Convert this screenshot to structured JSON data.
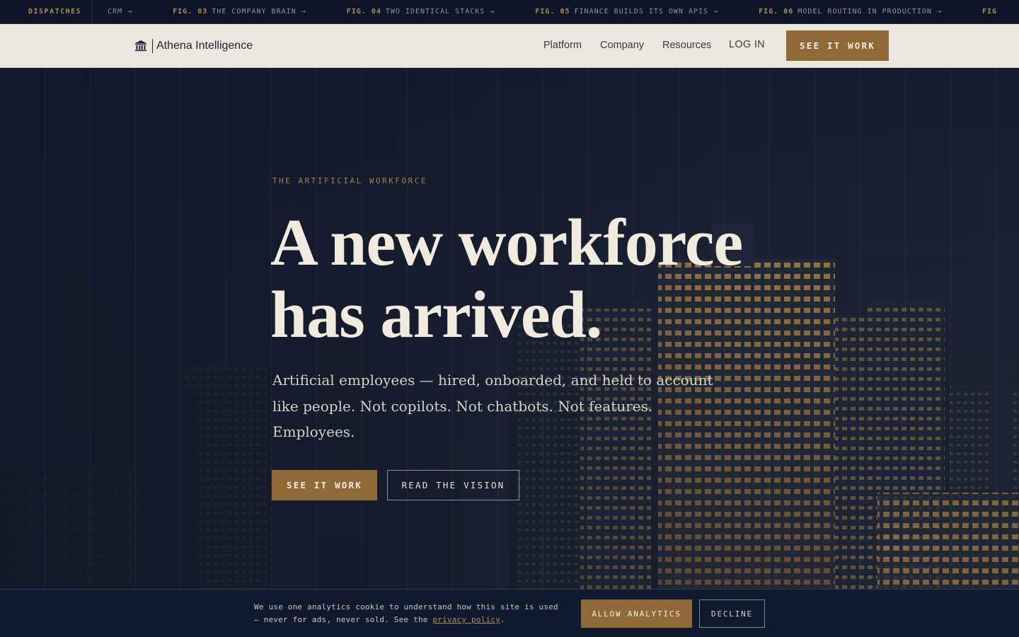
{
  "ticker": {
    "label": "DISPATCHES",
    "items": [
      {
        "fig": "",
        "text": "CRM →"
      },
      {
        "fig": "FIG. 03",
        "text": "THE COMPANY BRAIN →"
      },
      {
        "fig": "FIG. 04",
        "text": "TWO IDENTICAL STACKS →"
      },
      {
        "fig": "FIG. 05",
        "text": "FINANCE BUILDS ITS OWN APIS →"
      },
      {
        "fig": "FIG. 06",
        "text": "MODEL ROUTING IN PRODUCTION →"
      },
      {
        "fig": "FIG",
        "text": ""
      }
    ]
  },
  "nav": {
    "logo_text": "Athena Intelligence",
    "links": [
      "Platform",
      "Company",
      "Resources"
    ],
    "login": "LOG IN",
    "cta": "SEE IT WORK"
  },
  "hero": {
    "eyebrow": "THE ARTIFICIAL WORKFORCE",
    "headline_line1": "A new workforce",
    "headline_line2": "has arrived.",
    "subhead": "Artificial employees — hired, onboarded, and held to account like people. Not copilots. Not chatbots. Not features. Employees.",
    "primary_cta": "SEE IT WORK",
    "secondary_cta": "READ THE VISION"
  },
  "cookie": {
    "text_before": "We use one analytics cookie to understand how this site is used — never for ads, never sold. See the ",
    "link": "privacy policy",
    "text_after": ".",
    "allow": "ALLOW ANALYTICS",
    "decline": "DECLINE"
  },
  "colors": {
    "accent": "#8f6a38",
    "ink": "#101a2c",
    "paper": "#ece7dd"
  }
}
